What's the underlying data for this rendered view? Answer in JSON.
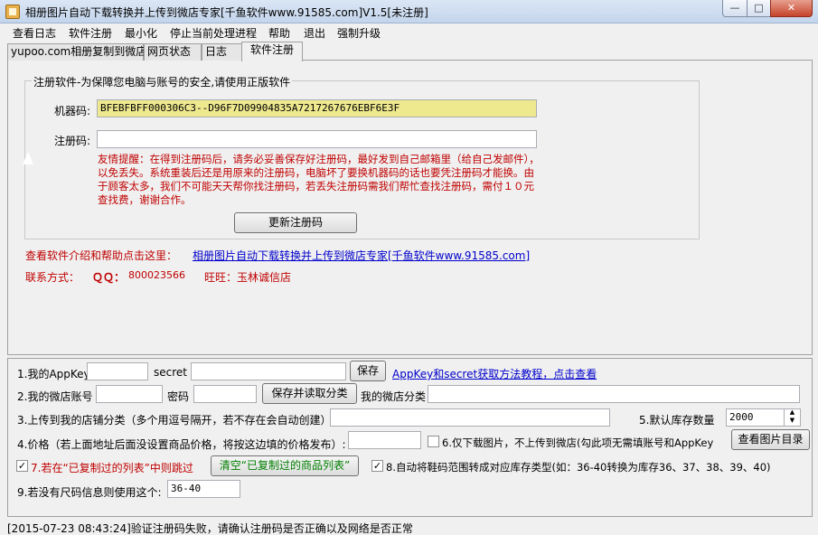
{
  "window": {
    "title": "相册图片自动下载转换并上传到微店专家[千鱼软件www.91585.com]V1.5[未注册]",
    "min_glyph": "—",
    "max_glyph": "□",
    "close_glyph": "✕"
  },
  "menu": [
    "查看日志",
    "软件注册",
    "最小化",
    "停止当前处理进程",
    "帮助",
    "退出",
    "强制升级"
  ],
  "tabs": [
    "yupoo.com相册复制到微店",
    "网页状态",
    "日志",
    "软件注册"
  ],
  "registration": {
    "group_title": "注册软件-为保障您电脑与账号的安全,请使用正版软件",
    "machine_code_label": "机器码:",
    "machine_code_value": "BFEBFBFF000306C3--D96F7D09904835A7217267676EBF6E3F",
    "reg_code_label": "注册码:",
    "reg_code_value": "",
    "warning": "友情提醒：在得到注册码后，请务必妥善保存好注册码，最好发到自己邮箱里（给自己发邮件），以免丢失。系统重装后还是用原来的注册码，电脑坏了要换机器码的话也要凭注册码才能换。由于顾客太多，我们不可能天天帮你找注册码，若丢失注册码需我们帮忙查找注册码，需付１０元查找费，谢谢合作。",
    "update_button": "更新注册码"
  },
  "help": {
    "intro_label": "查看软件介绍和帮助点击这里：",
    "intro_link": "相册图片自动下载转换并上传到微店专家[千鱼软件www.91585.com]",
    "contact_label": "联系方式：",
    "qq_label": "ＱＱ：",
    "qq_value": "800023566",
    "wangwang_label": "旺旺：",
    "wangwang_value": "玉林诚信店"
  },
  "settings": {
    "appkey_label": "1.我的AppKey",
    "appkey_value": "",
    "secret_label": "secret",
    "secret_value": "",
    "save_button": "保存",
    "appkey_help_link": "AppKey和secret获取方法教程，点击查看",
    "shop_account_label": "2.我的微店账号",
    "shop_account_value": "",
    "password_label": "密码",
    "password_value": "",
    "save_read_button": "保存并读取分类",
    "my_categories_label": "我的微店分类",
    "my_categories_value": "",
    "upload_category_label": "3.上传到我的店铺分类（多个用逗号隔开，若不存在会自动创建）:",
    "upload_category_value": "",
    "stock_label": "5.默认库存数量",
    "stock_value": "2000",
    "price_label": "4.价格（若上面地址后面没设置商品价格，将按这边填的价格发布）:",
    "price_value": "",
    "download_only_label": "6.仅下载图片，不上传到微店(勾此项无需填账号和AppKey",
    "download_only_checked": "",
    "view_images_button": "查看图片目录",
    "skip_copied_checked": "✓",
    "skip_copied_label": "7.若在“已复制过的列表”中则跳过",
    "clear_copied_button": "清空“已复制过的商品列表”",
    "shoe_size_checked": "✓",
    "shoe_size_label": "8.自动将鞋码范围转成对应库存类型(如：36-40转换为库存36、37、38、39、40)",
    "size_label": "9.若没有尺码信息则使用这个:",
    "size_value": "36-40"
  },
  "status": "[2015-07-23 08:43:24]验证注册码失败，请确认注册码是否正确以及网络是否正常"
}
